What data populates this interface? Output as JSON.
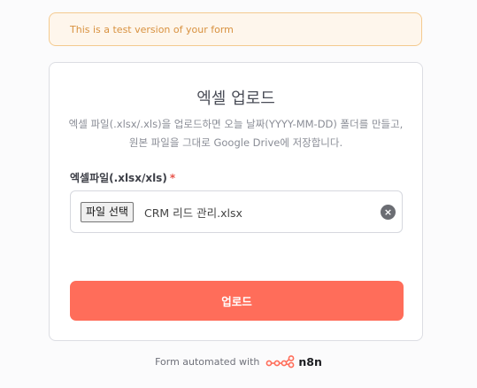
{
  "banner": {
    "text": "This is a test version of your form"
  },
  "form": {
    "title": "엑셀 업로드",
    "description": "엑셀 파일(.xlsx/.xls)을 업로드하면 오늘 날짜(YYYY-MM-DD) 폴더를 만들고, 원본 파일을 그대로 Google Drive에 저장합니다.",
    "field": {
      "label": "엑셀파일(.xlsx/xls)",
      "required_mark": "*",
      "choose_button": "파일 선택",
      "file_name": "CRM 리드 관리.xlsx",
      "clear_icon": "close-icon"
    },
    "submit_label": "업로드"
  },
  "footer": {
    "text": "Form automated with",
    "brand": "n8n",
    "logo_icon": "n8n-logo-icon",
    "accent_color": "#ff6d5a"
  }
}
